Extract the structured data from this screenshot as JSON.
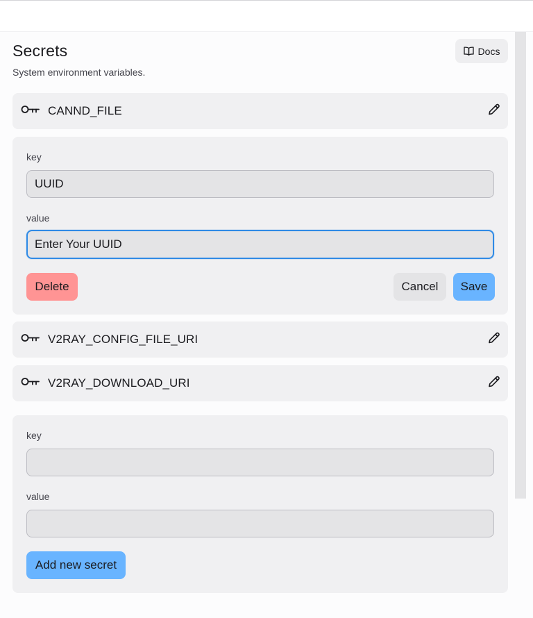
{
  "header": {
    "title": "Secrets",
    "subtitle": "System environment variables.",
    "docs_label": "Docs"
  },
  "secrets": [
    {
      "name": "CANND_FILE"
    },
    {
      "name": "V2RAY_CONFIG_FILE_URI"
    },
    {
      "name": "V2RAY_DOWNLOAD_URI"
    }
  ],
  "edit_form": {
    "key_label": "key",
    "key_value": "UUID",
    "value_label": "value",
    "value_placeholder": "Enter Your UUID",
    "delete_label": "Delete",
    "cancel_label": "Cancel",
    "save_label": "Save"
  },
  "new_form": {
    "key_label": "key",
    "key_value": "",
    "value_label": "value",
    "value_value": "",
    "add_label": "Add new secret"
  },
  "icons": {
    "docs": "book-open-icon",
    "secret": "key-icon",
    "edit": "pencil-icon"
  },
  "colors": {
    "delete": "#ff9494",
    "primary": "#69b4ff",
    "focus": "#2f8ae6",
    "card": "#f0f0f2"
  }
}
